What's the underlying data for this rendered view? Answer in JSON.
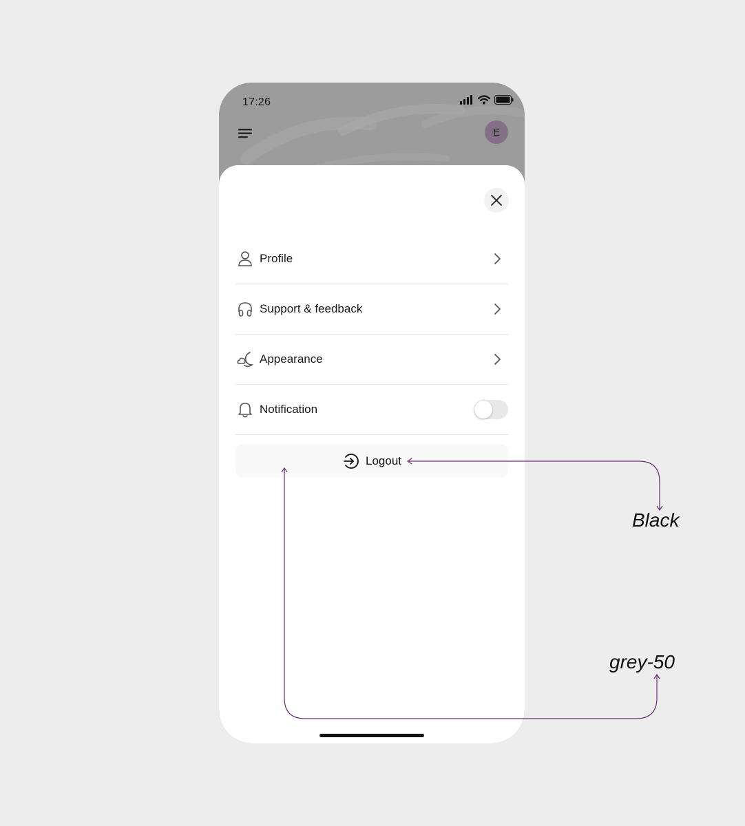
{
  "status_bar": {
    "time": "17:26"
  },
  "header": {
    "avatar_initial": "E"
  },
  "menu": {
    "items": [
      {
        "label": "Profile",
        "icon": "user-icon"
      },
      {
        "label": "Support & feedback",
        "icon": "headphones-icon"
      },
      {
        "label": "Appearance",
        "icon": "moon-cloud-icon"
      },
      {
        "label": "Notification",
        "icon": "bell-icon",
        "toggle_on": false
      }
    ]
  },
  "logout": {
    "label": "Logout",
    "icon": "logout-icon"
  },
  "annotations": {
    "text_color_label": "Black",
    "background_color_label": "grey-50"
  },
  "colors": {
    "page_background": "#ededed",
    "annotation_line": "#6b2a78",
    "logout_background": "#f9f9f9",
    "avatar": "#836f86"
  }
}
